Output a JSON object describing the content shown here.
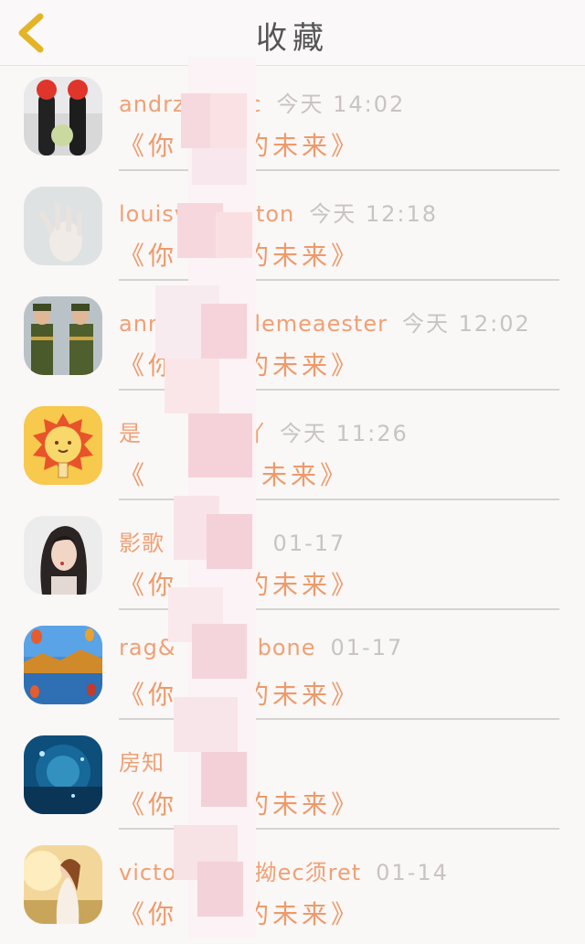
{
  "header": {
    "title": "收藏"
  },
  "icons": {
    "back": "chevron-left-icon"
  },
  "colors": {
    "accent": "#ef9b6a",
    "muted": "#c9c3c3",
    "back": "#e3b526"
  },
  "items": [
    {
      "name": "andrzo",
      "name_tail": "c",
      "time": "今天 14:02",
      "work": "《你",
      "work_tail": "的未来》"
    },
    {
      "name": "louisv",
      "name_tail": "ton",
      "time": "今天 12:18",
      "work": "《你",
      "work_tail": "的未来》"
    },
    {
      "name": "ann",
      "name_tail": "ulemeaester",
      "time": "今天 12:02",
      "work": "《你",
      "work_tail": "的未来》"
    },
    {
      "name": "是",
      "name_tail": "吖",
      "time": "今天 11:26",
      "work": "《",
      "work_tail": "的未来》"
    },
    {
      "name": "影歌",
      "name_tail": "12",
      "time": "01-17",
      "work": "《你",
      "work_tail": "的未来》"
    },
    {
      "name": "rag&",
      "name_tail": ";bone",
      "time": "01-17",
      "work": "《你",
      "work_tail": "的未来》"
    },
    {
      "name": "房知",
      "name_tail": "",
      "time": "",
      "work": "《你",
      "work_tail": "的未来》"
    },
    {
      "name": "victo",
      "name_tail": "s拗ec须ret",
      "time": "01-14",
      "work": "《你",
      "work_tail": "的未来》"
    }
  ]
}
